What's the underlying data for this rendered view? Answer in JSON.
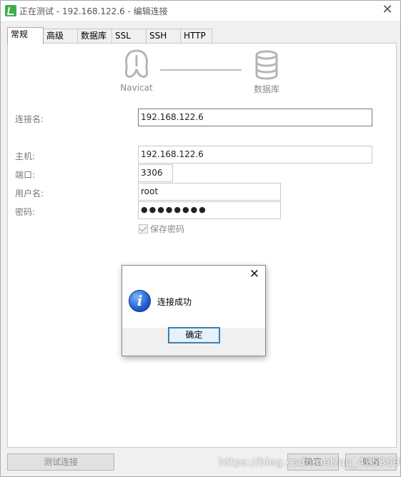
{
  "window": {
    "title": "正在测试 - 192.168.122.6 - 编辑连接"
  },
  "tabs": [
    {
      "label": "常规"
    },
    {
      "label": "高级"
    },
    {
      "label": "数据库"
    },
    {
      "label": "SSL"
    },
    {
      "label": "SSH"
    },
    {
      "label": "HTTP"
    }
  ],
  "header": {
    "left_logo_label": "Navicat",
    "right_logo_label": "数据库"
  },
  "form": {
    "connection_name_label": "连接名:",
    "connection_name_value": "192.168.122.6",
    "host_label": "主机:",
    "host_value": "192.168.122.6",
    "port_label": "端口:",
    "port_value": "3306",
    "username_label": "用户名:",
    "username_value": "root",
    "password_label": "密码:",
    "password_value": "●●●●●●●●",
    "save_password_label": "保存密码",
    "save_password_checked": true
  },
  "footer": {
    "test_button": "测试连接",
    "ok_button": "确定",
    "cancel_button": "取消"
  },
  "watermark": "https://blog.csdn.net/qq_42538990",
  "dialog": {
    "message": "连接成功",
    "ok_button": "确定",
    "close": "✕"
  },
  "icons": {
    "app": "navicat-icon",
    "info": "info-icon",
    "left_logo": "navicat-logo-icon",
    "right_logo": "database-icon"
  }
}
